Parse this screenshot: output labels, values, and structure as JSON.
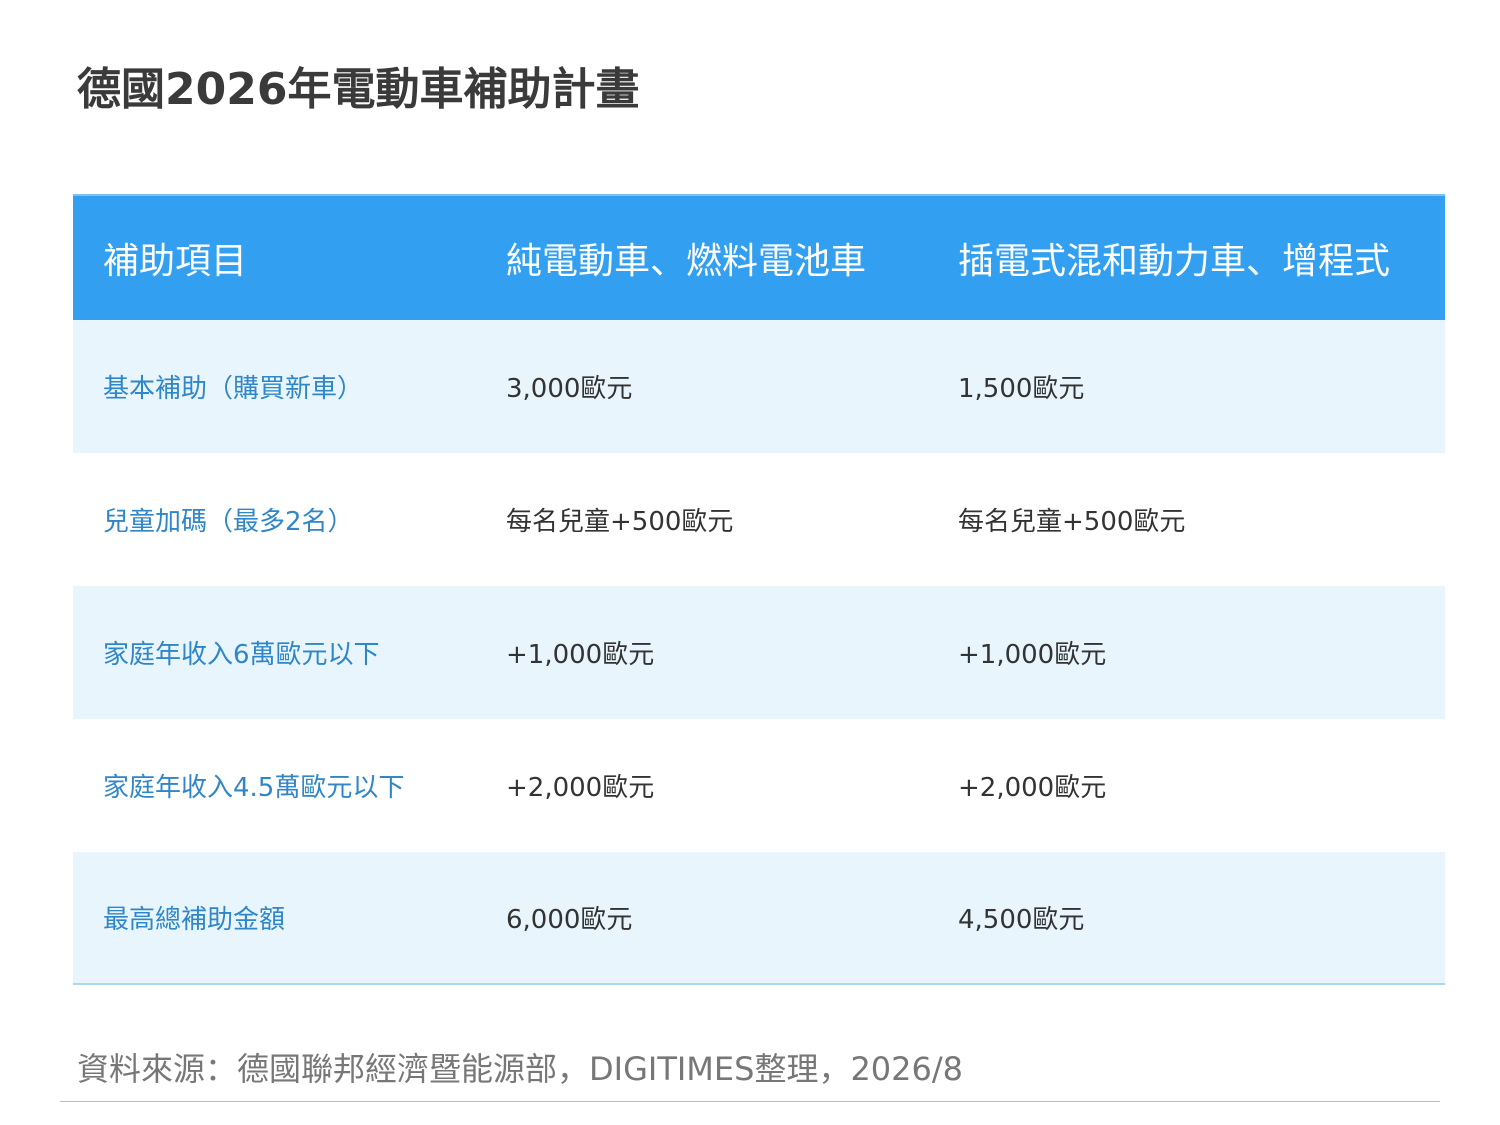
{
  "title": "德國2026年電動車補助計畫",
  "table": {
    "headers": [
      "補助項目",
      "純電動車、燃料電池車",
      "插電式混和動力車、增程式"
    ],
    "rows": [
      [
        "基本補助（購買新車）",
        "3,000歐元",
        "1,500歐元"
      ],
      [
        "兒童加碼（最多2名）",
        "每名兒童+500歐元",
        "每名兒童+500歐元"
      ],
      [
        "家庭年收入6萬歐元以下",
        "+1,000歐元",
        "+1,000歐元"
      ],
      [
        "家庭年收入4.5萬歐元以下",
        "+2,000歐元",
        "+2,000歐元"
      ],
      [
        "最高總補助金額",
        "6,000歐元",
        "4,500歐元"
      ]
    ]
  },
  "source": "資料來源：德國聯邦經濟暨能源部，DIGITIMES整理，2026/8",
  "colors": {
    "header_bg": "#339ff0",
    "row_alt_bg": "#e8f5fd",
    "item_text": "#2f86c9"
  }
}
